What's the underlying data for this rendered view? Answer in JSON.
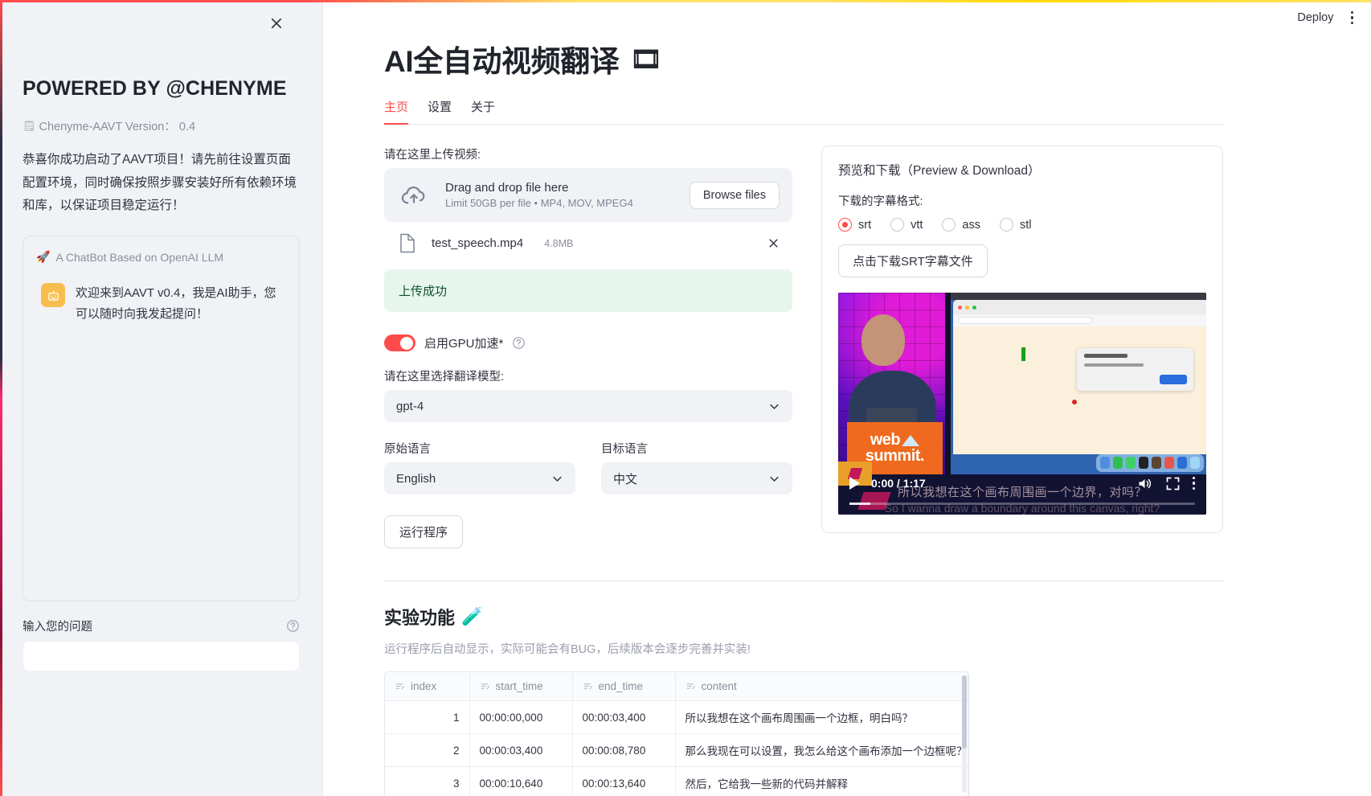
{
  "topbar": {
    "deploy_label": "Deploy",
    "menu_icon": "kebab-menu-icon"
  },
  "sidebar": {
    "close_icon": "close-icon",
    "title": "POWERED BY @CHENYME",
    "version_icon": "document-icon",
    "version_text": "Chenyme-AAVT Version： 0.4",
    "description": "恭喜你成功启动了AAVT项目！请先前往设置页面配置环境，同时确保按照步骤安装好所有依赖环境和库，以保证项目稳定运行！",
    "chat": {
      "header_icon": "rocket-icon",
      "header": "A ChatBot Based on OpenAI LLM",
      "avatar_icon": "robot-icon",
      "message": "欢迎来到AAVT v0.4，我是AI助手，您可以随时向我发起提问！"
    },
    "input_label": "输入您的问题",
    "input_help_icon": "help-circle-icon",
    "input_value": "",
    "input_placeholder": ""
  },
  "main": {
    "page_title": "AI全自动视频翻译",
    "title_emoji": "🎞",
    "tabs": [
      {
        "label": "主页",
        "active": true
      },
      {
        "label": "设置",
        "active": false
      },
      {
        "label": "关于",
        "active": false
      }
    ],
    "upload": {
      "label": "请在这里上传视频:",
      "dropzone_icon": "cloud-upload-icon",
      "dropzone_title": "Drag and drop file here",
      "dropzone_sub": "Limit 50GB per file • MP4, MOV, MPEG4",
      "browse_label": "Browse files",
      "file_icon": "file-icon",
      "file_name": "test_speech.mp4",
      "file_size": "4.8MB",
      "remove_icon": "close-icon",
      "success_message": "上传成功"
    },
    "gpu": {
      "enabled": true,
      "label": "启用GPU加速*",
      "help_icon": "help-circle-icon"
    },
    "model": {
      "label": "请在这里选择翻译模型:",
      "value": "gpt-4",
      "chevron_icon": "chevron-down-icon"
    },
    "source_language": {
      "label": "原始语言",
      "value": "English",
      "chevron_icon": "chevron-down-icon"
    },
    "target_language": {
      "label": "目标语言",
      "value": "中文",
      "chevron_icon": "chevron-down-icon"
    },
    "run_button": "运行程序",
    "preview": {
      "title": "预览和下载（Preview & Download）",
      "subtitle_format_label": "下载的字幕格式:",
      "formats": [
        {
          "label": "srt",
          "selected": true
        },
        {
          "label": "vtt",
          "selected": false
        },
        {
          "label": "ass",
          "selected": false
        },
        {
          "label": "stl",
          "selected": false
        }
      ],
      "download_button": "点击下载SRT字幕文件",
      "video": {
        "podium_line1": "web",
        "podium_line2": "summit.",
        "current_time": "0:00",
        "duration": "1:17",
        "time_display": "0:00 / 1:17",
        "play_icon": "play-icon",
        "volume_icon": "volume-icon",
        "fullscreen_icon": "fullscreen-icon",
        "menu_icon": "kebab-menu-icon",
        "subtitle_cn": "所以我想在这个画布周围画一个边界，对吗？",
        "subtitle_en": "So I wanna draw a boundary around this canvas, right?",
        "progress_percent": 6
      }
    },
    "experimental": {
      "title": "实验功能",
      "title_emoji": "🧪",
      "subtitle": "运行程序后自动显示，实际可能会有BUG，后续版本会逐步完善并实装!",
      "table": {
        "header_icon": "column-sort-icon",
        "columns": [
          "index",
          "start_time",
          "end_time",
          "content"
        ],
        "rows": [
          {
            "index": "1",
            "start_time": "00:00:00,000",
            "end_time": "00:00:03,400",
            "content": "所以我想在这个画布周围画一个边框，明白吗？"
          },
          {
            "index": "2",
            "start_time": "00:00:03,400",
            "end_time": "00:00:08,780",
            "content": "那么我现在可以设置，我怎么给这个画布添加一个边框呢？"
          },
          {
            "index": "3",
            "start_time": "00:00:10,640",
            "end_time": "00:00:13,640",
            "content": "然后，它给我一些新的代码并解释"
          }
        ]
      }
    }
  },
  "colors": {
    "accent": "#ff4b4b",
    "sidebar_bg": "#f0f2f6",
    "success_bg": "#e7f6ec",
    "success_text": "#0f5132"
  }
}
